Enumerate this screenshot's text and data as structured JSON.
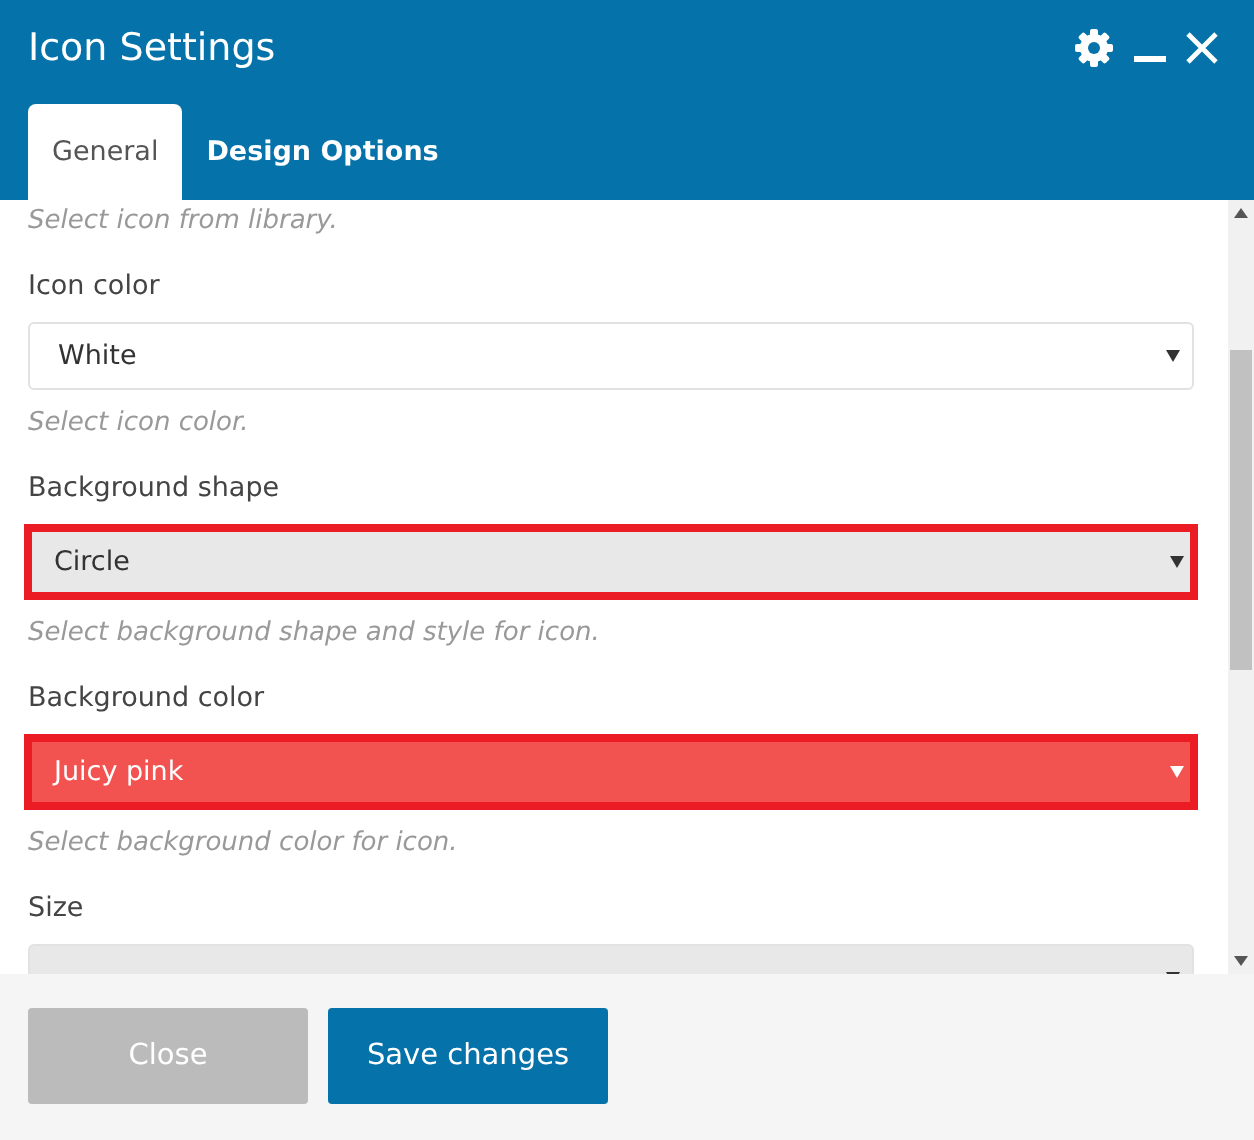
{
  "window": {
    "title": "Icon Settings"
  },
  "tabs": [
    {
      "label": "General",
      "selected": true
    },
    {
      "label": "Design Options",
      "selected": false
    }
  ],
  "intro_help": "Select icon from library.",
  "fields": [
    {
      "label": "Icon color",
      "value": "White",
      "help": "Select icon color.",
      "highlighted": false,
      "color": "#ffffff"
    },
    {
      "label": "Background shape",
      "value": "Circle",
      "help": "Select background shape and style for icon.",
      "highlighted": true,
      "color": "#e8e8e8"
    },
    {
      "label": "Background color",
      "value": "Juicy pink",
      "help": "Select background color for icon.",
      "highlighted": true,
      "color": "#f25350"
    },
    {
      "label": "Size",
      "highlighted": false,
      "color": "#e8e8e8"
    }
  ],
  "buttons": [
    {
      "label": "Close",
      "kind": "secondary"
    },
    {
      "label": "Save changes",
      "kind": "primary"
    }
  ]
}
